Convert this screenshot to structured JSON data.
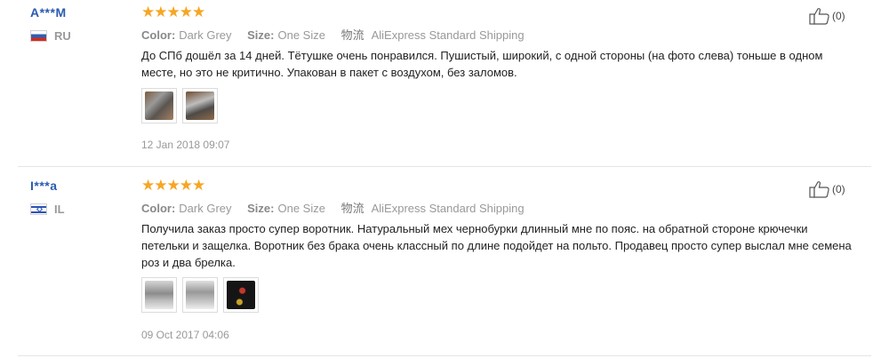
{
  "reviews": [
    {
      "user": "A***M",
      "country": "RU",
      "rating": "★★★★★",
      "color_label": "Color:",
      "color_value": "Dark Grey",
      "size_label": "Size:",
      "size_value": "One Size",
      "shipping_icon_label": "物流",
      "shipping": "AliExpress Standard Shipping",
      "text": "До СПб дошёл за 14 дней. Тётушке очень понравился. Пушистый, широкий, с одной стороны (на фото слева) тоньше в одном месте, но это не критично. Упакован в пакет с воздухом, без заломов.",
      "photos": 2,
      "date": "12 Jan 2018 09:07",
      "helpful_count": "(0)"
    },
    {
      "user": "I***a",
      "country": "IL",
      "rating": "★★★★★",
      "color_label": "Color:",
      "color_value": "Dark Grey",
      "size_label": "Size:",
      "size_value": "One Size",
      "shipping_icon_label": "物流",
      "shipping": "AliExpress Standard Shipping",
      "text": "Получила заказ просто супер воротник. Натуральный мех чернобурки длинный мне по пояс. на обратной стороне крючечки петельки и защелка. Воротник без брака очень классный по длине подойдет на польто. Продавец просто супер выслал мне семена роз и два брелка.",
      "photos": 3,
      "date": "09 Oct 2017 04:06",
      "helpful_count": "(0)"
    }
  ],
  "icons": {
    "like": "thumbs-up-icon",
    "flag_ru": "flag-ru-icon",
    "flag_il": "flag-il-icon"
  },
  "colors": {
    "star": "#f6a623",
    "username": "#2a5bb0",
    "muted": "#999999"
  }
}
